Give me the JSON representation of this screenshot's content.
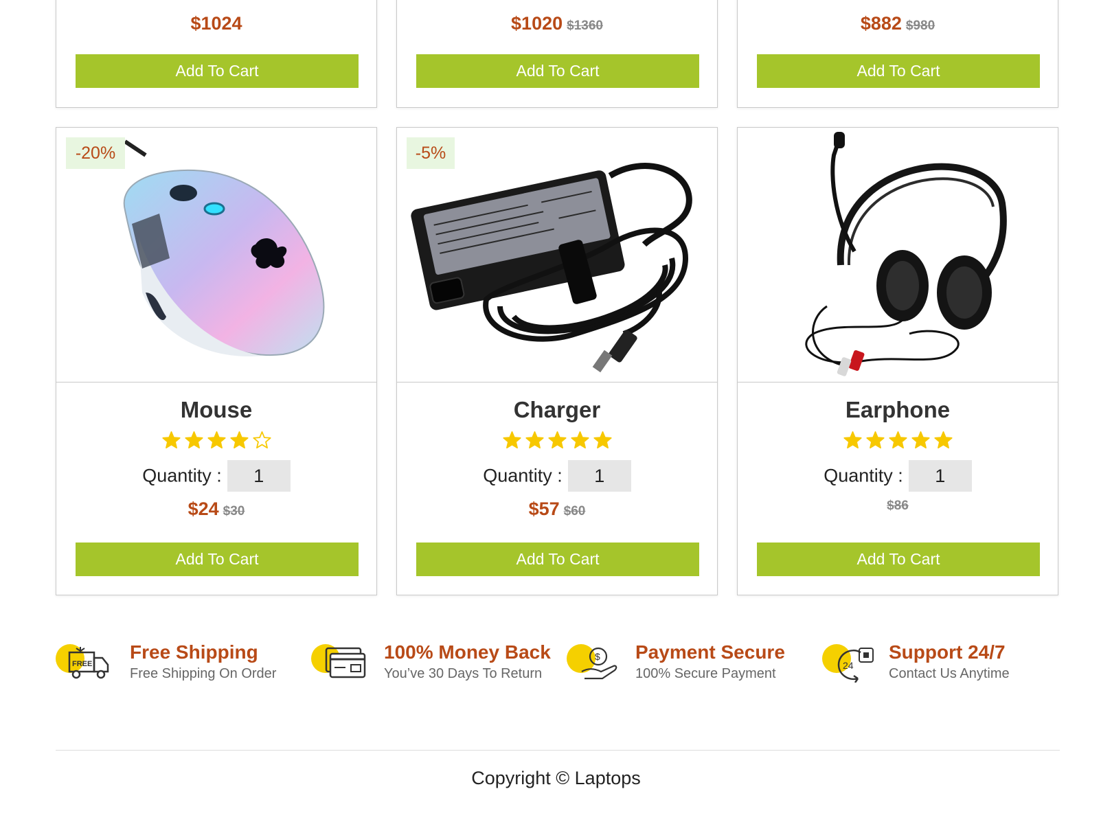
{
  "top_cards": [
    {
      "price": "$1024",
      "old_price": "",
      "button": "Add To Cart"
    },
    {
      "price": "$1020",
      "old_price": "$1360",
      "button": "Add To Cart"
    },
    {
      "price": "$882",
      "old_price": "$980",
      "button": "Add To Cart"
    }
  ],
  "products": [
    {
      "name": "Mouse",
      "discount": "-20%",
      "rating": 4,
      "max_rating": 5,
      "quantity_label": "Quantity :",
      "quantity": "1",
      "price": "$24",
      "old_price": "$30",
      "button": "Add To Cart",
      "image": "mouse-image"
    },
    {
      "name": "Charger",
      "discount": "-5%",
      "rating": 5,
      "max_rating": 5,
      "quantity_label": "Quantity :",
      "quantity": "1",
      "price": "$57",
      "old_price": "$60",
      "button": "Add To Cart",
      "image": "charger-image"
    },
    {
      "name": "Earphone",
      "discount": "",
      "rating": 5,
      "max_rating": 5,
      "quantity_label": "Quantity :",
      "quantity": "1",
      "price": "",
      "old_price": "$86",
      "button": "Add To Cart",
      "image": "earphone-image"
    }
  ],
  "features": [
    {
      "title": "Free Shipping",
      "subtitle": "Free Shipping On Order",
      "icon": "free-shipping-truck-icon",
      "icon_text": "FREE"
    },
    {
      "title": "100% Money Back",
      "subtitle": "You’ve 30 Days To Return",
      "icon": "money-back-card-icon"
    },
    {
      "title": "Payment Secure",
      "subtitle": "100% Secure Payment",
      "icon": "secure-payment-hand-icon"
    },
    {
      "title": "Support 24/7",
      "subtitle": "Contact Us Anytime",
      "icon": "support-24-7-icon",
      "icon_text": "24"
    }
  ],
  "footer": {
    "copyright": "Copyright © Laptops"
  },
  "colors": {
    "accent": "#a5c52b",
    "price": "#b84a17",
    "star": "#f7c800",
    "highlight": "#f5d000"
  }
}
